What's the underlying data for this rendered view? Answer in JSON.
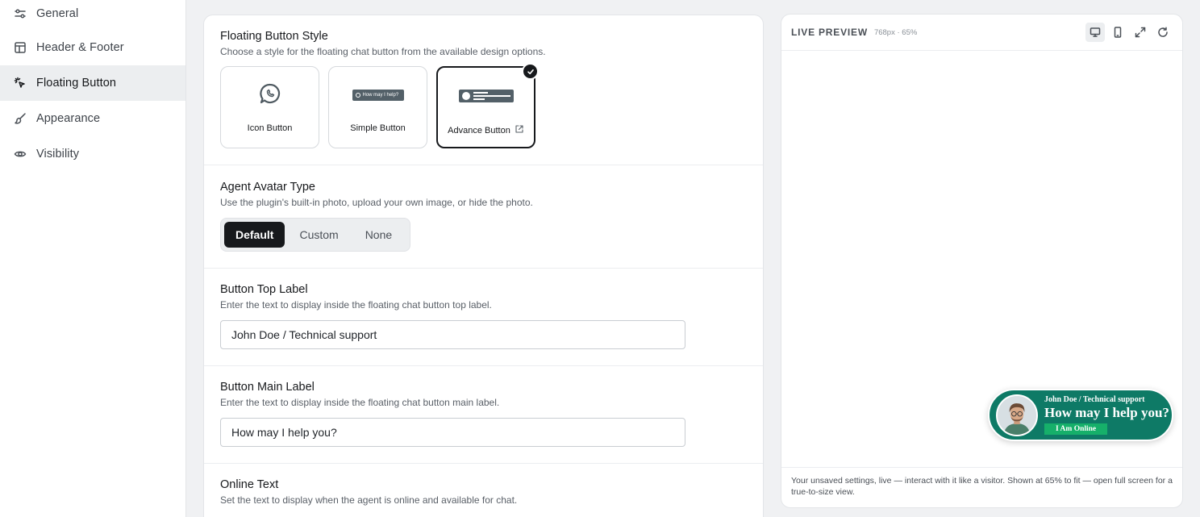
{
  "sidebar": {
    "items": [
      {
        "label": "General",
        "icon": "sliders-icon"
      },
      {
        "label": "Header & Footer",
        "icon": "layout-icon"
      },
      {
        "label": "Floating Button",
        "icon": "pointer-click-icon",
        "active": true
      },
      {
        "label": "Appearance",
        "icon": "brush-icon"
      },
      {
        "label": "Visibility",
        "icon": "eye-icon"
      }
    ]
  },
  "button_style": {
    "title": "Floating Button Style",
    "description": "Choose a style for the floating chat button from the available design options.",
    "options": [
      {
        "label": "Icon Button",
        "icon": "chat-bubble-icon"
      },
      {
        "label": "Simple Button",
        "mini_text": "How may I help?"
      },
      {
        "label": "Advance Button",
        "icon": "external-link-icon",
        "selected": true
      }
    ]
  },
  "avatar_type": {
    "title": "Agent Avatar Type",
    "description": "Use the plugin's built-in photo, upload your own image, or hide the photo.",
    "options": [
      "Default",
      "Custom",
      "None"
    ],
    "selected": "Default"
  },
  "top_label": {
    "title": "Button Top Label",
    "description": "Enter the text to display inside the floating chat button top label.",
    "value": "John Doe / Technical support"
  },
  "main_label": {
    "title": "Button Main Label",
    "description": "Enter the text to display inside the floating chat button main label.",
    "value": "How may I help you?"
  },
  "online_text": {
    "title": "Online Text",
    "description": "Set the text to display when the agent is online and available for chat."
  },
  "preview": {
    "title": "LIVE PREVIEW",
    "meta": "768px · 65%",
    "tools": [
      "desktop-icon",
      "mobile-icon",
      "expand-icon",
      "refresh-icon"
    ],
    "button": {
      "top_label": "John Doe / Technical support",
      "main_label": "How may I help you?",
      "online": "I Am Online"
    },
    "footer": "Your unsaved settings, live — interact with it like a visitor. Shown at 65% to fit — open full screen for a true-to-size view."
  },
  "colors": {
    "accent": "#17191c",
    "fab_bg": "#0e7a66",
    "online_badge": "#16b06a",
    "mini_button": "#536068"
  }
}
